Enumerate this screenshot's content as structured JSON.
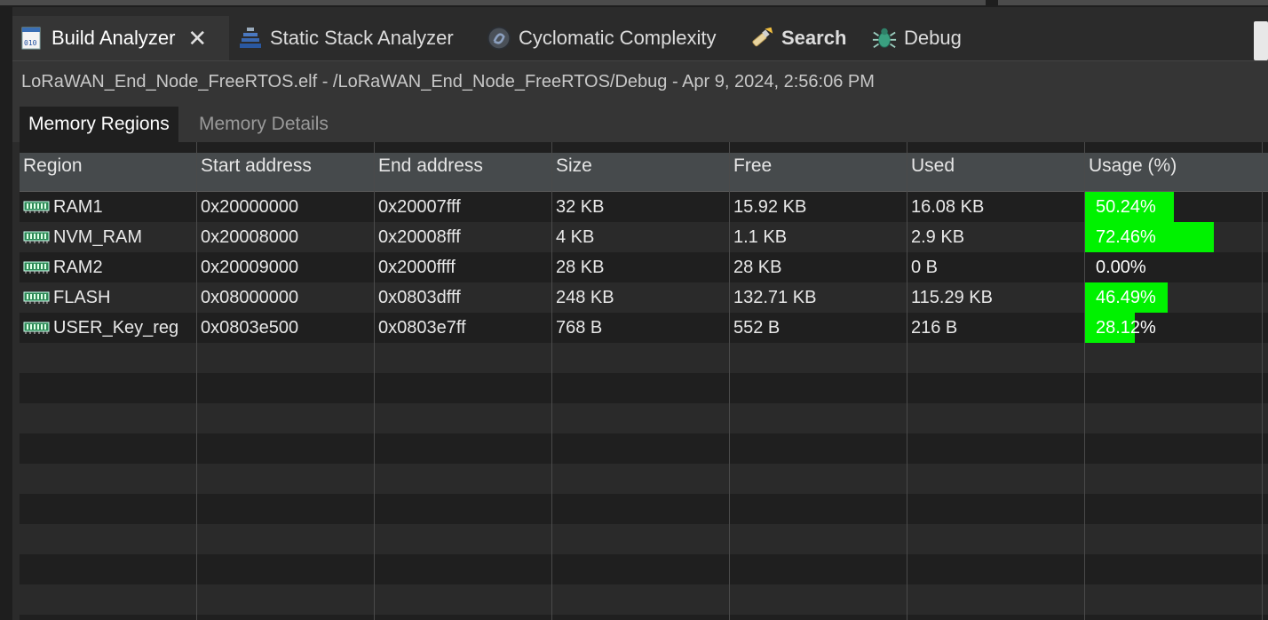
{
  "tabs": [
    {
      "label": "Build Analyzer",
      "icon": "build-analyzer-icon",
      "active": true,
      "closable": true
    },
    {
      "label": "Static Stack Analyzer",
      "icon": "stack-icon"
    },
    {
      "label": "Cyclomatic Complexity",
      "icon": "complexity-icon"
    },
    {
      "label": "Search",
      "icon": "search-flashlight-icon",
      "bold": true
    },
    {
      "label": "Debug",
      "icon": "debug-bug-icon"
    }
  ],
  "title": "LoRaWAN_End_Node_FreeRTOS.elf - /LoRaWAN_End_Node_FreeRTOS/Debug - Apr 9, 2024, 2:56:06 PM",
  "inner_tabs": [
    "Memory Regions",
    "Memory Details"
  ],
  "table": {
    "columns": [
      "Region",
      "Start address",
      "End address",
      "Size",
      "Free",
      "Used",
      "Usage (%)"
    ],
    "rows": [
      {
        "region": "RAM1",
        "start": "0x20000000",
        "end": "0x20007fff",
        "size": "32 KB",
        "free": "15.92 KB",
        "used": "16.08 KB",
        "usage": "50.24%",
        "usage_value": 50.24
      },
      {
        "region": "NVM_RAM",
        "start": "0x20008000",
        "end": "0x20008fff",
        "size": "4 KB",
        "free": "1.1 KB",
        "used": "2.9 KB",
        "usage": "72.46%",
        "usage_value": 72.46
      },
      {
        "region": "RAM2",
        "start": "0x20009000",
        "end": "0x2000ffff",
        "size": "28 KB",
        "free": "28 KB",
        "used": "0 B",
        "usage": "0.00%",
        "usage_value": 0
      },
      {
        "region": "FLASH",
        "start": "0x08000000",
        "end": "0x0803dfff",
        "size": "248 KB",
        "free": "132.71 KB",
        "used": "115.29 KB",
        "usage": "46.49%",
        "usage_value": 46.49
      },
      {
        "region": "USER_Key_reg",
        "start": "0x0803e500",
        "end": "0x0803e7ff",
        "size": "768 B",
        "free": "552 B",
        "used": "216 B",
        "usage": "28.12%",
        "usage_value": 28.12
      }
    ]
  },
  "colors": {
    "usage_bar": "#00f200"
  }
}
